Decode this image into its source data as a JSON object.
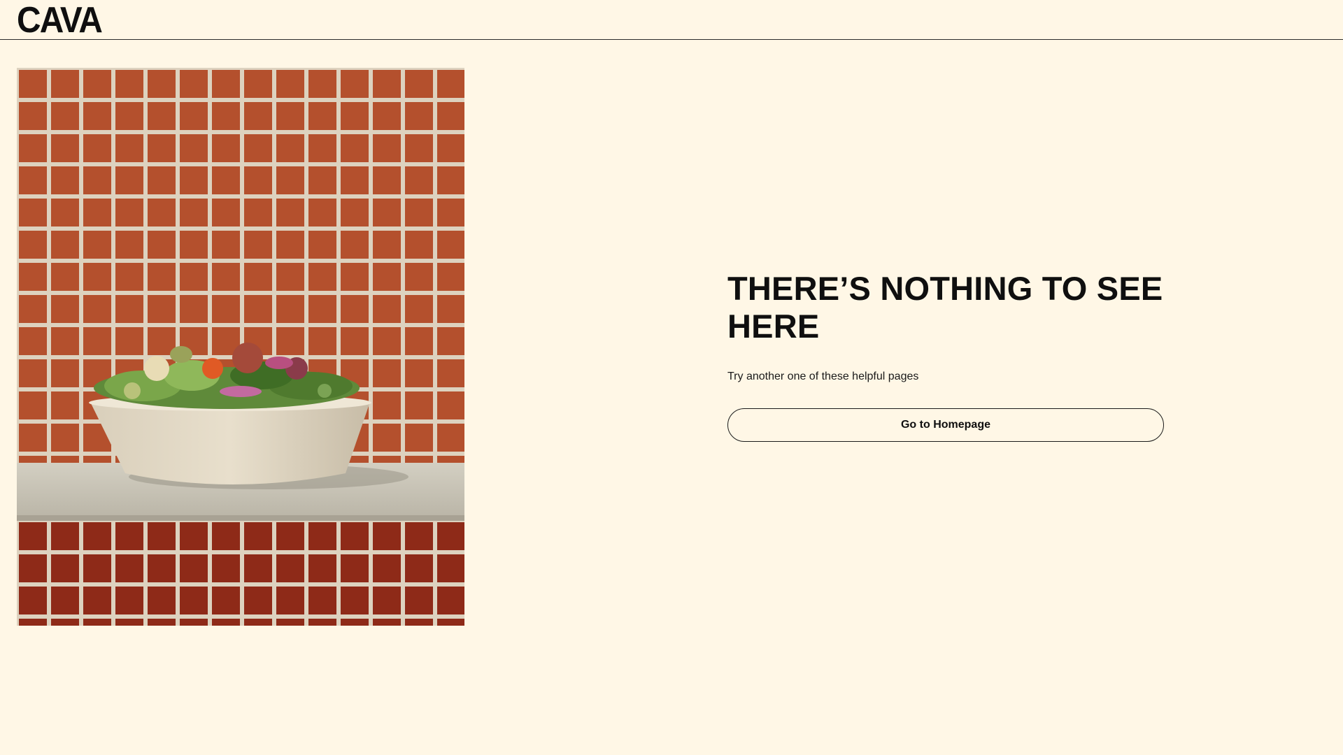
{
  "header": {
    "logo_text": "CAVA"
  },
  "hero_image": {
    "icon": "salad-bowl-on-tiled-wall-photo",
    "colors": {
      "tile": "#b4502d",
      "grout": "#ddd2bf",
      "lower_tile": "#8e2a18",
      "ledge": "#c9c5b8",
      "bowl": "#e2d8c4"
    }
  },
  "main": {
    "headline": "THERE’S NOTHING TO SEE HERE",
    "subtext": "Try another one of these helpful pages",
    "home_button_label": "Go to Homepage"
  },
  "theme": {
    "background": "#fff7e6",
    "text": "#0f0f0f"
  }
}
